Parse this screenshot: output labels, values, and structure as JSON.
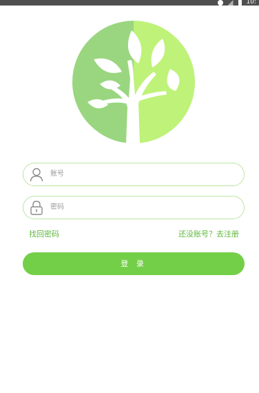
{
  "status_bar": {
    "time": "10:"
  },
  "logo": {
    "icon": "tree-logo",
    "colors": {
      "left": "#9ad67f",
      "right": "#bff279",
      "trunk": "#ffffff"
    }
  },
  "login_form": {
    "username_field": {
      "icon": "user-icon",
      "placeholder": "账号"
    },
    "password_field": {
      "icon": "lock-icon",
      "placeholder": "密码"
    },
    "forgot_password_link": "找回密码",
    "register_link": "还没账号？去注册",
    "login_button": "登 录"
  },
  "colors": {
    "accent": "#73cf47",
    "link": "#5fb83c",
    "field_border": "#b9e6a1"
  }
}
